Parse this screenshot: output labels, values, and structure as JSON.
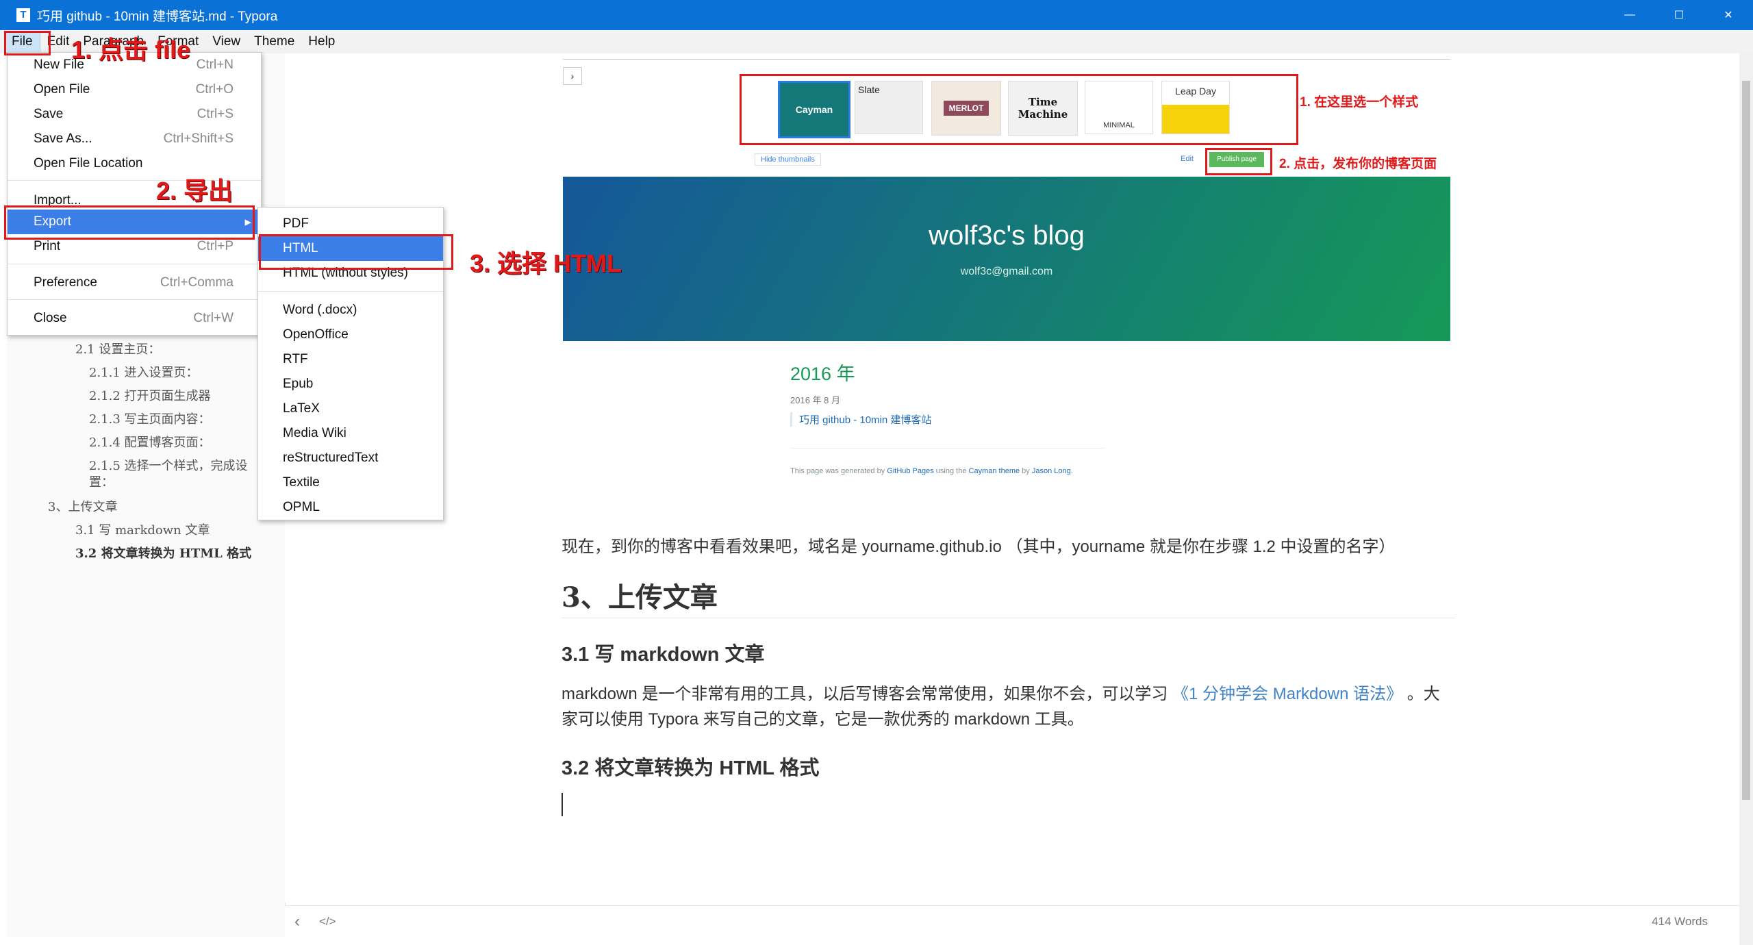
{
  "window": {
    "title": "巧用 github - 10min 建博客站.md - Typora",
    "app_icon": "T",
    "minimize_icon": "—",
    "maximize_icon": "☐",
    "close_icon": "✕"
  },
  "menubar": [
    "File",
    "Edit",
    "Paragraph",
    "Format",
    "View",
    "Theme",
    "Help"
  ],
  "file_menu": [
    {
      "label": "New File",
      "shortcut": "Ctrl+N"
    },
    {
      "label": "Open File",
      "shortcut": "Ctrl+O"
    },
    {
      "label": "Save",
      "shortcut": "Ctrl+S"
    },
    {
      "label": "Save As...",
      "shortcut": "Ctrl+Shift+S"
    },
    {
      "label": "Open File Location",
      "shortcut": ""
    },
    {
      "label": "Import...",
      "shortcut": ""
    },
    {
      "label": "Export",
      "shortcut": "▸"
    },
    {
      "label": "Print",
      "shortcut": "Ctrl+P"
    },
    {
      "label": "Preference",
      "shortcut": "Ctrl+Comma"
    },
    {
      "label": "Close",
      "shortcut": "Ctrl+W"
    }
  ],
  "export_menu": [
    "PDF",
    "HTML",
    "HTML (without styles)",
    "Word (.docx)",
    "OpenOffice",
    "RTF",
    "Epub",
    "LaTeX",
    "Media Wiki",
    "reStructuredText",
    "Textile",
    "OPML"
  ],
  "annotations": {
    "step1": "1. 点击 file",
    "step2": "2. 导出",
    "step3": "3. 选择 HTML"
  },
  "toc": [
    {
      "label": "2.1 设置主页：",
      "level": 2
    },
    {
      "label": "2.1.1 进入设置页：",
      "level": 3
    },
    {
      "label": "2.1.2 打开页面生成器",
      "level": 3
    },
    {
      "label": "2.1.3 写主页面内容：",
      "level": 3
    },
    {
      "label": "2.1.4 配置博客页面：",
      "level": 3
    },
    {
      "label": "2.1.5 选择一个样式，完成设",
      "level": 3
    },
    {
      "label": "置：",
      "level": 3
    },
    {
      "label": "3、上传文章",
      "level": 1
    },
    {
      "label": "3.1 写 markdown 文章",
      "level": 2
    },
    {
      "label": "3.2 将文章转换为 HTML 格式",
      "level": 2,
      "active": true
    }
  ],
  "embedded_screenshot": {
    "themes": [
      "Cayman",
      "Slate",
      "MERLOT",
      "Time Machine",
      "MINIMAL",
      "Leap Day"
    ],
    "note_select": "1. 在这里选一个样式",
    "note_publish": "2. 点击，发布你的博客页面",
    "hide_thumbnails": "Hide thumbnails",
    "edit": "Edit",
    "publish_page": "Publish page",
    "blog_title": "wolf3c's blog",
    "blog_email": "wolf3c@gmail.com",
    "year_heading": "2016 年",
    "month": "2016 年 8 月",
    "post_link": "巧用 github - 10min 建博客站",
    "footer_prefix": "This page was generated by ",
    "footer_link1": "GitHub Pages",
    "footer_mid": " using the ",
    "footer_link2": "Cayman theme",
    "footer_by": " by ",
    "footer_link3": "Jason Long",
    "footer_end": "."
  },
  "document": {
    "para1": "现在，到你的博客中看看效果吧，域名是 yourname.github.io （其中，yourname 就是你在步骤 1.2 中设置的名字）",
    "h2": "3、上传文章",
    "h3_1": "3.1 写 markdown 文章",
    "para2_a": "markdown 是一个非常有用的工具，以后写博客会常常使用，如果你不会，可以学习 ",
    "para2_link": "《1 分钟学会 Markdown 语法》",
    "para2_b": " 。大",
    "para2_c": "家可以使用 Typora 来写自己的文章，它是一款优秀的 markdown 工具。",
    "h3_2": "3.2 将文章转换为 HTML 格式"
  },
  "status": {
    "back_icon": "‹",
    "source_icon": "</>",
    "word_count": "414 Words"
  },
  "colors": {
    "titlebar": "#0a72d6",
    "menu_highlight": "#3c7ee8",
    "annotation_red": "#e01a1a",
    "banner_start": "#155799",
    "banner_end": "#159957"
  }
}
